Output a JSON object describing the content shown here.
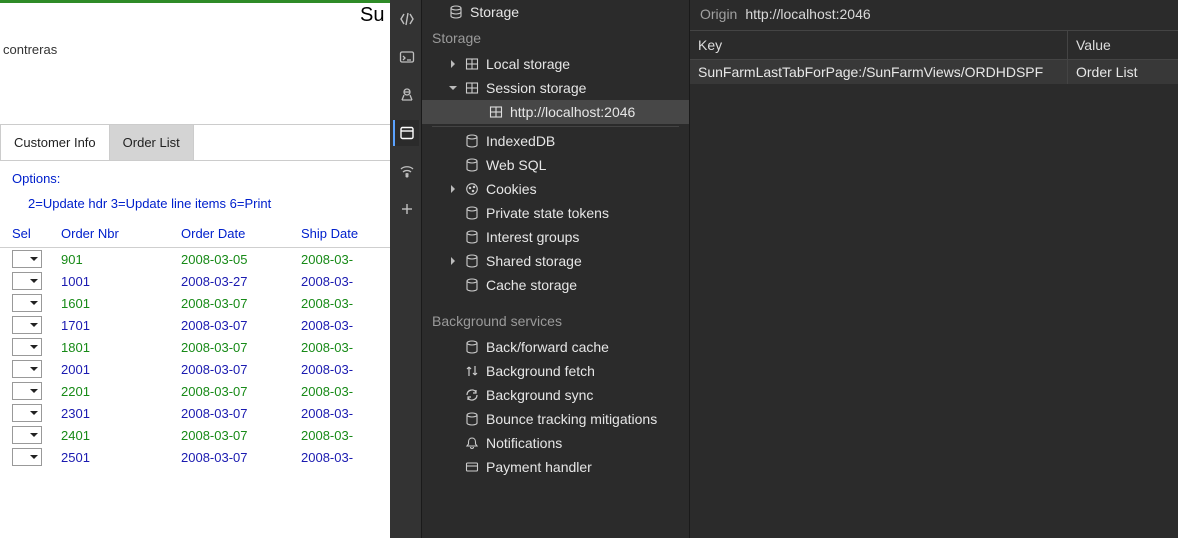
{
  "app": {
    "title_fragment": "Su",
    "user": "contreras",
    "tabs": [
      {
        "label": "Customer Info",
        "active": false
      },
      {
        "label": "Order List",
        "active": true
      }
    ],
    "options_label": "Options:",
    "options_line": "2=Update hdr  3=Update line items  6=Print",
    "columns": {
      "sel": "Sel",
      "order_nbr": "Order Nbr",
      "order_date": "Order Date",
      "ship_date": "Ship Date"
    },
    "rows": [
      {
        "nbr": "901",
        "odate": "2008-03-05",
        "sdate": "2008-03-",
        "color": "green"
      },
      {
        "nbr": "1001",
        "odate": "2008-03-27",
        "sdate": "2008-03-",
        "color": "blue"
      },
      {
        "nbr": "1601",
        "odate": "2008-03-07",
        "sdate": "2008-03-",
        "color": "green"
      },
      {
        "nbr": "1701",
        "odate": "2008-03-07",
        "sdate": "2008-03-",
        "color": "blue"
      },
      {
        "nbr": "1801",
        "odate": "2008-03-07",
        "sdate": "2008-03-",
        "color": "green"
      },
      {
        "nbr": "2001",
        "odate": "2008-03-07",
        "sdate": "2008-03-",
        "color": "blue"
      },
      {
        "nbr": "2201",
        "odate": "2008-03-07",
        "sdate": "2008-03-",
        "color": "green"
      },
      {
        "nbr": "2301",
        "odate": "2008-03-07",
        "sdate": "2008-03-",
        "color": "blue"
      },
      {
        "nbr": "2401",
        "odate": "2008-03-07",
        "sdate": "2008-03-",
        "color": "green"
      },
      {
        "nbr": "2501",
        "odate": "2008-03-07",
        "sdate": "2008-03-",
        "color": "blue"
      }
    ]
  },
  "devtools": {
    "tree": {
      "top_item": "Storage",
      "group_storage": "Storage",
      "storage_items": {
        "local_storage": "Local storage",
        "session_storage": "Session storage",
        "session_child": "http://localhost:2046",
        "indexeddb": "IndexedDB",
        "websql": "Web SQL",
        "cookies": "Cookies",
        "pst": "Private state tokens",
        "interest": "Interest groups",
        "shared": "Shared storage",
        "cache": "Cache storage"
      },
      "group_bg": "Background services",
      "bg_items": {
        "bf_cache": "Back/forward cache",
        "bg_fetch": "Background fetch",
        "bg_sync": "Background sync",
        "bounce": "Bounce tracking mitigations",
        "notif": "Notifications",
        "payment": "Payment handler"
      }
    },
    "detail": {
      "origin_label": "Origin",
      "origin_url": "http://localhost:2046",
      "key_header": "Key",
      "value_header": "Value",
      "row_key": "SunFarmLastTabForPage:/SunFarmViews/ORDHDSPF",
      "row_value": "Order List"
    }
  }
}
